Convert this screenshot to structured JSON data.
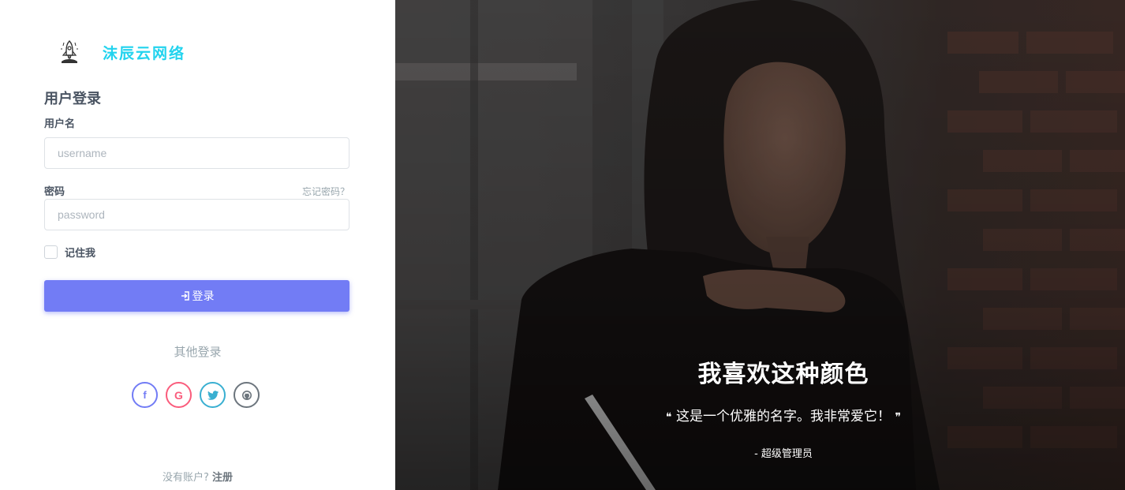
{
  "brand": {
    "name": "沫辰云网络",
    "logo_icon": "rocket-icon",
    "color": "#22d3ee"
  },
  "login": {
    "heading": "用户登录",
    "username": {
      "label": "用户名",
      "placeholder": "username",
      "value": ""
    },
    "password": {
      "label": "密码",
      "placeholder": "password",
      "value": "",
      "forgot_link": "忘记密码？"
    },
    "remember": {
      "label": "记住我",
      "checked": false
    },
    "submit_label": "登录",
    "submit_icon": "login-icon",
    "accent_color": "#727cf5",
    "other_login": "其他登录",
    "social": [
      {
        "name": "facebook",
        "glyph": "f",
        "color": "#727cf5"
      },
      {
        "name": "google",
        "glyph": "G",
        "color": "#fa5c7c"
      },
      {
        "name": "twitter",
        "glyph": "t",
        "color": "#39afd1"
      },
      {
        "name": "github",
        "glyph": "gh",
        "color": "#6c757d"
      }
    ],
    "signup_prompt": "没有账户?",
    "signup_link": "注册"
  },
  "quote": {
    "title": "我喜欢这种颜色",
    "text": "这是一个优雅的名字。我非常爱它！",
    "open_mark": "❝",
    "close_mark": "❞",
    "author": "- 超级管理员"
  }
}
